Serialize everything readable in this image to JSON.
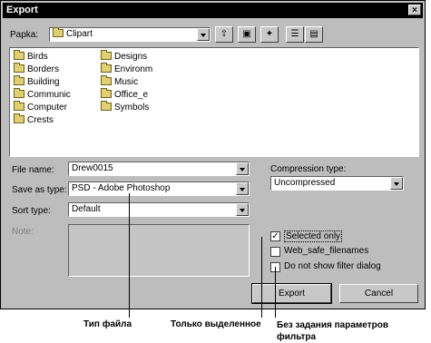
{
  "window": {
    "title": "Export",
    "close_glyph": "×"
  },
  "look_in": {
    "label": "Papka:",
    "value": "Clipart"
  },
  "toolbar": {
    "icons": [
      "up-folder-icon",
      "desktop-icon",
      "new-folder-icon",
      "list-view-icon",
      "details-view-icon"
    ]
  },
  "folders": {
    "col1": [
      "Birds",
      "Borders",
      "Building",
      "Communic",
      "Computer",
      "Crests"
    ],
    "col2": [
      "Designs",
      "Environm",
      "Music",
      "Office_e",
      "Symbols"
    ]
  },
  "file_name": {
    "label": "File name:",
    "value": "Drew0015"
  },
  "save_as_type": {
    "label": "Save as type:",
    "value": "PSD - Adobe Photoshop"
  },
  "sort_type": {
    "label": "Sort type:",
    "value": "Default"
  },
  "notes": {
    "label": "Note:"
  },
  "compression": {
    "label": "Compression type:",
    "value": "Uncompressed"
  },
  "options": [
    {
      "label": "Selected only",
      "checked": true
    },
    {
      "label": "Web_safe_filenames",
      "checked": false
    },
    {
      "label": "Do not show filter dialog",
      "checked": false
    }
  ],
  "buttons": {
    "export": "Export",
    "cancel": "Cancel"
  },
  "annotations": {
    "file_type": "Тип файла",
    "selected_only": "Только выделенное",
    "no_filter_params": "Без задания параметров фильтра"
  }
}
